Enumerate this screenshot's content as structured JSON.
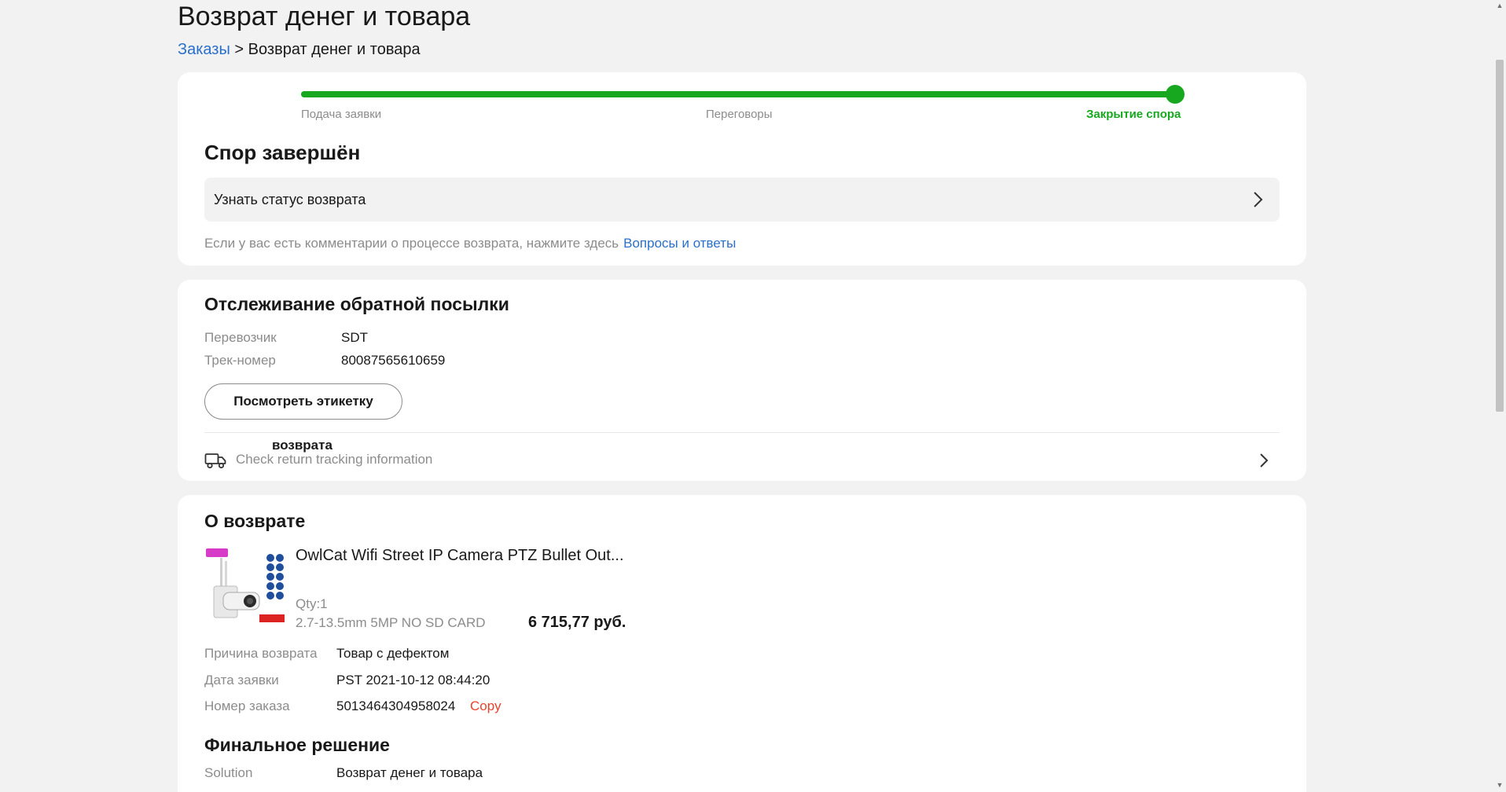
{
  "page": {
    "title": "Возврат денег и товара"
  },
  "breadcrumb": {
    "parent": "Заказы",
    "separator": ">",
    "current": "Возврат денег и товара"
  },
  "progress": {
    "value": 1.0,
    "steps": [
      "Подача заявки",
      "Переговоры",
      "Закрытие спора"
    ],
    "active_step": 2,
    "color": "#18a81f"
  },
  "status": {
    "heading": "Спор завершён",
    "status_row_label": "Узнать статус возврата",
    "note_text": "Если у вас есть комментарии о процессе возврата, нажмите здесь",
    "note_link": "Вопросы и ответы"
  },
  "tracking": {
    "heading": "Отслеживание обратной посылки",
    "carrier_label": "Перевозчик",
    "carrier_value": "SDT",
    "track_label": "Трек-номер",
    "track_value": "80087565610659",
    "label_button": "Посмотреть этикетку",
    "overlay_word": "возврата",
    "tracking_link": "Check return tracking information"
  },
  "return_info": {
    "heading": "О возврате",
    "product_title": "OwlCat Wifi Street IP Camera PTZ Bullet Out...",
    "qty": "Qty:1",
    "sku": "2.7-13.5mm 5MP NO SD CARD",
    "price": "6 715,77 руб.",
    "reason_label": "Причина возврата",
    "reason_value": "Товар с дефектом",
    "date_label": "Дата заявки",
    "date_value": "PST 2021-10-12 08:44:20",
    "order_label": "Номер заказа",
    "order_value": "5013464304958024",
    "copy_label": "Copy"
  },
  "final": {
    "heading": "Финальное решение",
    "solution_label": "Solution",
    "solution_value": "Возврат денег и товара"
  },
  "colors": {
    "accent_green": "#18a81f",
    "link_blue": "#2a6fc9",
    "copy_red": "#e8442d"
  }
}
